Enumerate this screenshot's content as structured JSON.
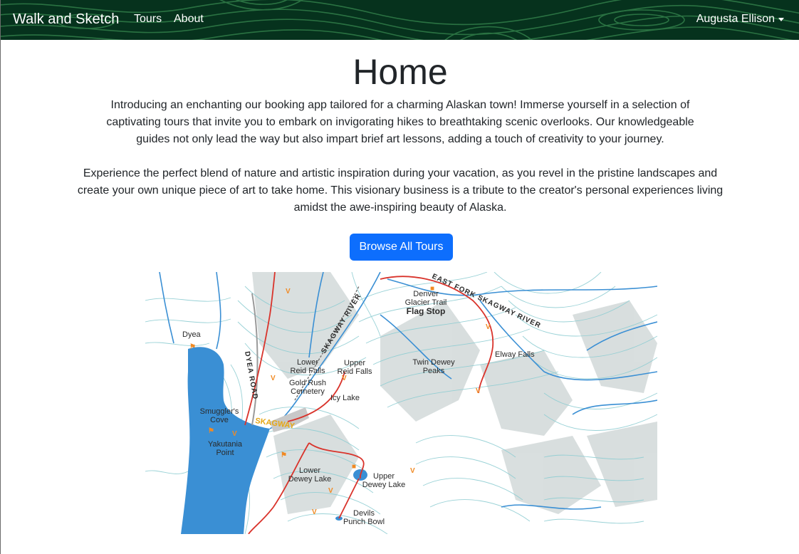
{
  "navbar": {
    "brand": "Walk and Sketch",
    "links": [
      "Tours",
      "About"
    ],
    "user": "Augusta Ellison"
  },
  "page": {
    "title": "Home",
    "intro": "Introducing an enchanting our booking app tailored for a charming Alaskan town! Immerse yourself in a selection of captivating tours that invite you to embark on invigorating hikes to breathtaking scenic overlooks. Our knowledgeable guides not only lead the way but also impart brief art lessons, adding a touch of creativity to your journey.",
    "experience": "Experience the perfect blend of nature and artistic inspiration during your vacation, as you revel in the pristine landscapes and create your own unique piece of art to take home. This visionary business is a tribute to the creator's personal experiences living amidst the awe-inspiring beauty of Alaska.",
    "cta_label": "Browse All Tours"
  },
  "map": {
    "labels": {
      "dyea": "Dyea",
      "dyea_road": "DYEA ROAD",
      "skagway_river": "SKAGWAY RIVER",
      "east_fork": "EAST FORK SKAGWAY RIVER",
      "denver_1": "Denver",
      "denver_2": "Glacier Trail",
      "flag_stop": "Flag Stop",
      "elway_falls": "Elway Falls",
      "lower_reid_1": "Lower",
      "lower_reid_2": "Reid Falls",
      "upper_reid_1": "Upper",
      "upper_reid_2": "Reid Falls",
      "twin_dewey_1": "Twin Dewey",
      "twin_dewey_2": "Peaks",
      "gold_rush_1": "Gold Rush",
      "gold_rush_2": "Cemetery",
      "icy_lake": "Icy Lake",
      "smugglers_1": "Smuggler's",
      "smugglers_2": "Cove",
      "skagway": "SKAGWAY",
      "yakutania_1": "Yakutania",
      "yakutania_2": "Point",
      "lower_dewey_1": "Lower",
      "lower_dewey_2": "Dewey Lake",
      "upper_dewey_1": "Upper",
      "upper_dewey_2": "Dewey Lake",
      "devils_1": "Devils",
      "devils_2": "Punch Bowl"
    },
    "colors": {
      "water": "#3a8fd4",
      "trail": "#d9332b",
      "land": "#ffffff",
      "contour": "#8ecdd2"
    }
  }
}
